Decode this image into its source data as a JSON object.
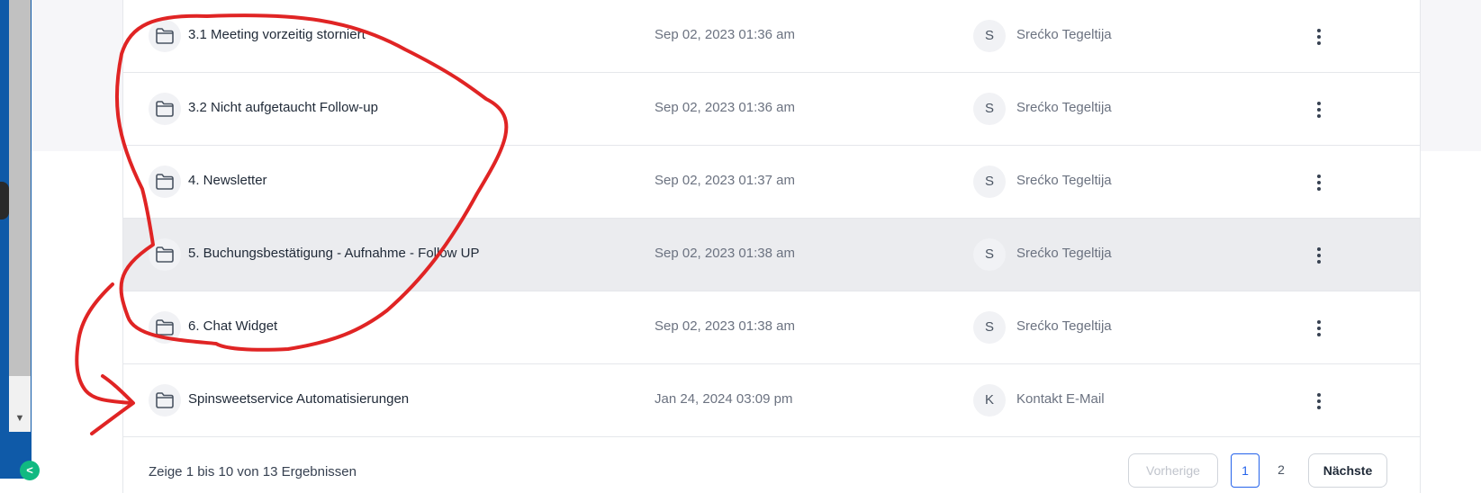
{
  "files": [
    {
      "name": "3.1 Meeting vorzeitig storniert",
      "date": "Sep 02, 2023 01:36 am",
      "owner_initial": "S",
      "owner": "Srećko Tegeltija"
    },
    {
      "name": "3.2 Nicht aufgetaucht Follow-up",
      "date": "Sep 02, 2023 01:36 am",
      "owner_initial": "S",
      "owner": "Srećko Tegeltija"
    },
    {
      "name": "4. Newsletter",
      "date": "Sep 02, 2023 01:37 am",
      "owner_initial": "S",
      "owner": "Srećko Tegeltija"
    },
    {
      "name": "5. Buchungsbestätigung - Aufnahme - Follow UP",
      "date": "Sep 02, 2023 01:38 am",
      "owner_initial": "S",
      "owner": "Srećko Tegeltija"
    },
    {
      "name": "6. Chat Widget",
      "date": "Sep 02, 2023 01:38 am",
      "owner_initial": "S",
      "owner": "Srećko Tegeltija"
    },
    {
      "name": "Spinsweetservice Automatisierungen",
      "date": "Jan 24, 2024 03:09 pm",
      "owner_initial": "K",
      "owner": "Kontakt E-Mail"
    }
  ],
  "highlighted_row": 3,
  "footer": {
    "results_text": "Zeige 1 bis 10 von 13 Ergebnissen",
    "prev_label": "Vorherige",
    "pages": [
      "1",
      "2"
    ],
    "current_page": "1",
    "next_label": "Nächste"
  },
  "icons": {
    "row_icon": "folder-icon",
    "row_action_icon": "more-vertical-icon",
    "scroll_arrow": "▼",
    "collapse_icon": "chevron-left-icon",
    "collapse_glyph": "<"
  },
  "colors": {
    "annotation": "#e02424",
    "accent": "#2563eb",
    "sidebar_blue": "#0f5aa8",
    "collapse_green": "#10b981"
  }
}
